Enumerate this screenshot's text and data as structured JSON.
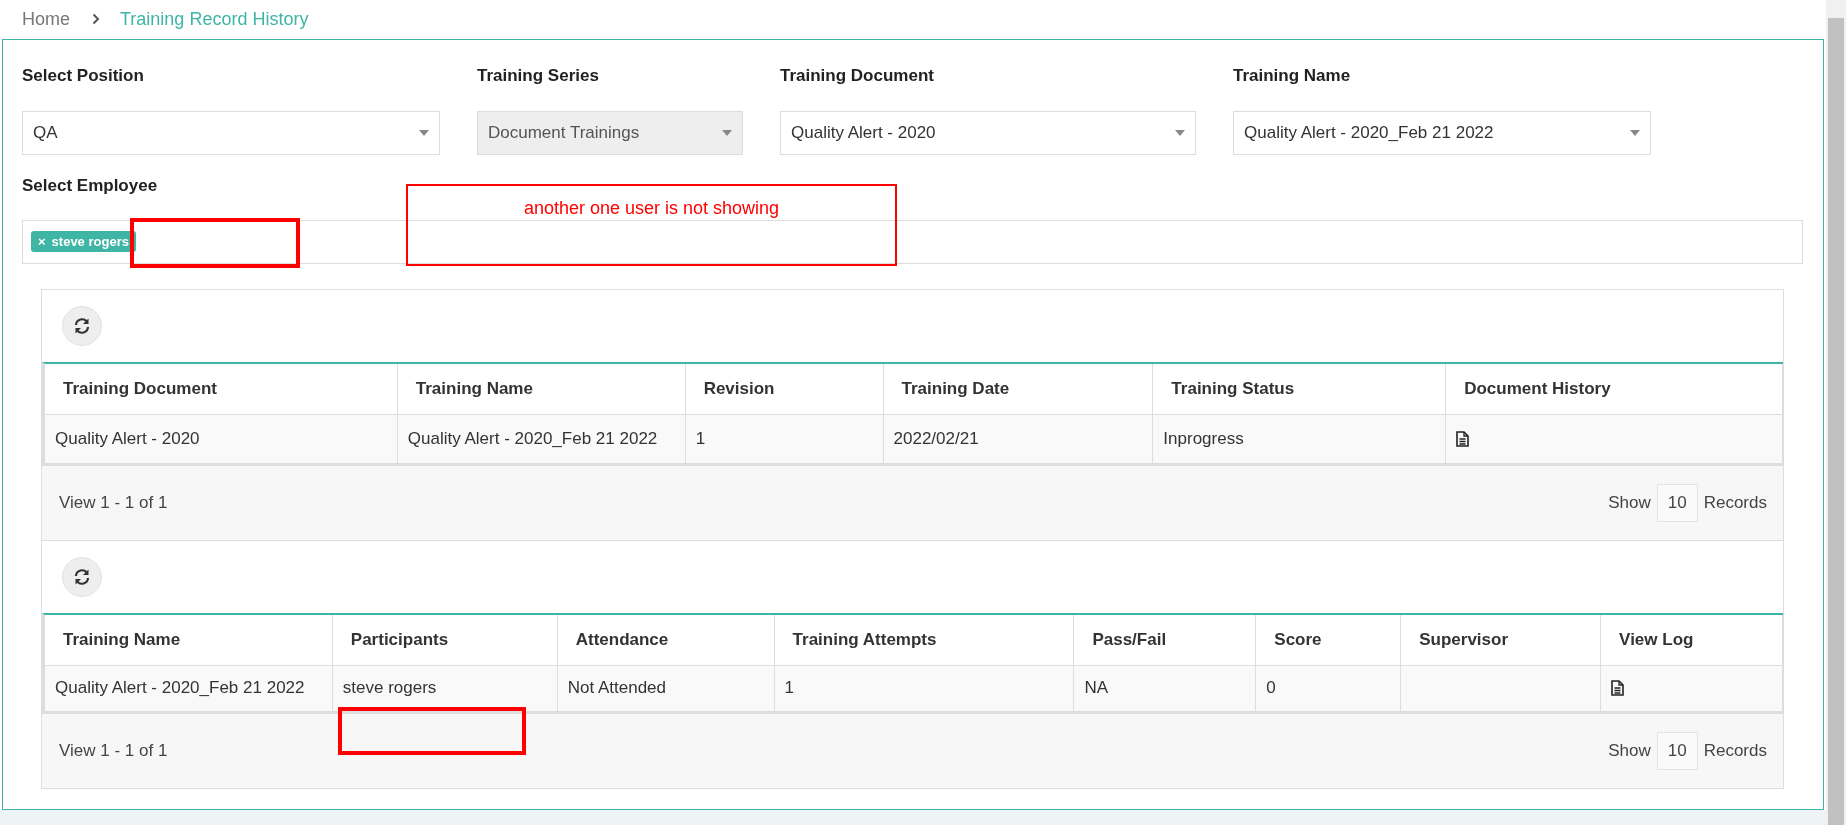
{
  "breadcrumb": [
    {
      "label": "Home",
      "current": false
    },
    {
      "label": "Training Record History",
      "current": true
    }
  ],
  "filters": [
    {
      "label": "Select Position",
      "value": "QA",
      "disabled": false
    },
    {
      "label": "Training Series",
      "value": "Document Trainings",
      "disabled": true
    },
    {
      "label": "Training Document",
      "value": "Quality Alert - 2020",
      "disabled": false
    },
    {
      "label": "Training Name",
      "value": "Quality Alert - 2020_Feb 21 2022",
      "disabled": false
    }
  ],
  "employee": {
    "label": "Select Employee",
    "tags": [
      {
        "remove": "×",
        "name": "steve rogers"
      }
    ]
  },
  "tables": [
    {
      "columns": [
        "Training Document",
        "Training Name",
        "Revision",
        "Training Date",
        "Training Status",
        "Document History"
      ],
      "rows": [
        [
          {
            "kind": "text",
            "text": "Quality Alert - 2020"
          },
          {
            "kind": "text",
            "text": "Quality Alert - 2020_Feb 21 2022"
          },
          {
            "kind": "text",
            "text": "1"
          },
          {
            "kind": "text",
            "text": "2022/02/21"
          },
          {
            "kind": "text",
            "text": "Inprogress"
          },
          {
            "kind": "icon"
          }
        ]
      ],
      "footer": {
        "view": "View 1 - 1 of 1",
        "show": "Show",
        "page_size": "10",
        "records": "Records"
      }
    },
    {
      "columns": [
        "Training Name",
        "Participants",
        "Attendance",
        "Training Attempts",
        "Pass/Fail",
        "Score",
        "Supervisor",
        "View Log"
      ],
      "rows": [
        [
          {
            "kind": "text",
            "text": "Quality Alert - 2020_Feb 21 2022"
          },
          {
            "kind": "text",
            "text": "steve rogers"
          },
          {
            "kind": "text",
            "text": "Not Attended"
          },
          {
            "kind": "text",
            "text": "1"
          },
          {
            "kind": "text",
            "text": "NA"
          },
          {
            "kind": "text",
            "text": "0"
          },
          {
            "kind": "empty"
          },
          {
            "kind": "icon"
          }
        ]
      ],
      "footer": {
        "view": "View 1 - 1 of 1",
        "show": "Show",
        "page_size": "10",
        "records": "Records"
      }
    }
  ],
  "annotations": [
    {
      "kind": "box"
    },
    {
      "kind": "note",
      "text": "another one user is not showing"
    },
    {
      "kind": "box"
    }
  ]
}
